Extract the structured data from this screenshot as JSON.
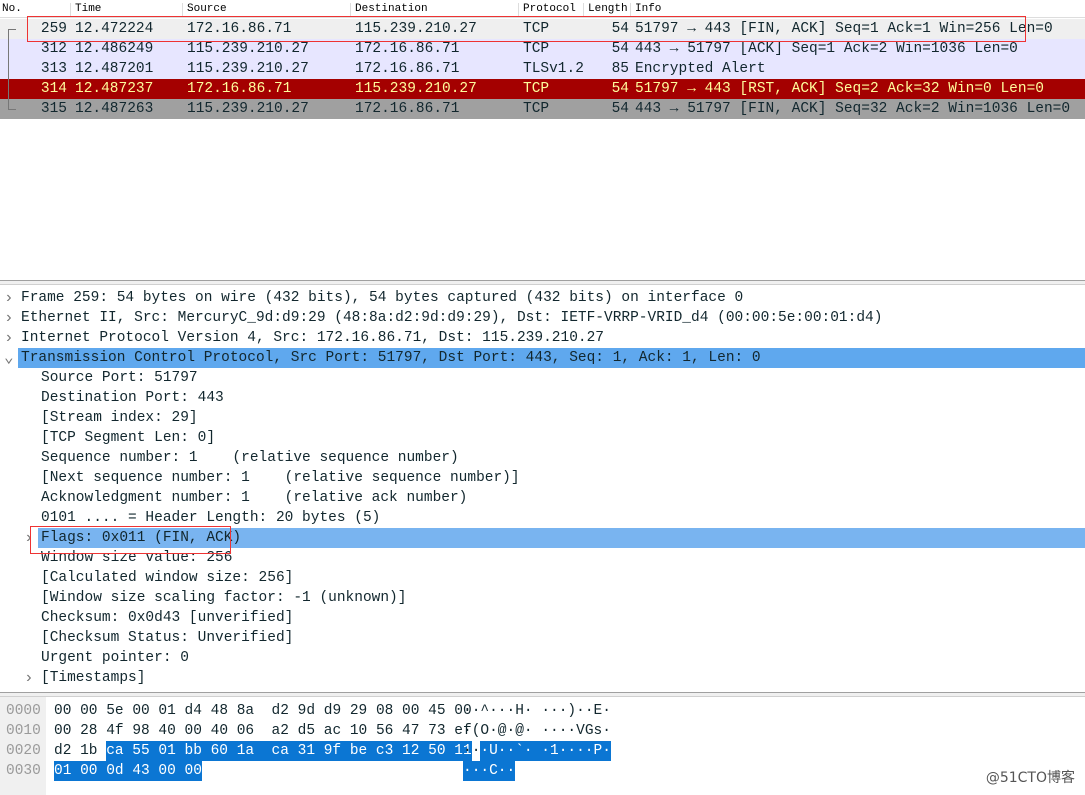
{
  "columns": {
    "no": "No.",
    "time": "Time",
    "source": "Source",
    "destination": "Destination",
    "protocol": "Protocol",
    "length": "Length",
    "info": "Info"
  },
  "packets": [
    {
      "no": "259",
      "time": "12.472224",
      "source": "172.16.86.71",
      "destination": "115.239.210.27",
      "protocol": "TCP",
      "length": "54",
      "info": "51797 → 443 [FIN, ACK] Seq=1 Ack=1 Win=256 Len=0",
      "bg": "#efefef",
      "fg": "#12272e"
    },
    {
      "no": "312",
      "time": "12.486249",
      "source": "115.239.210.27",
      "destination": "172.16.86.71",
      "protocol": "TCP",
      "length": "54",
      "info": "443 → 51797 [ACK] Seq=1 Ack=2 Win=1036 Len=0",
      "bg": "#e7e6ff",
      "fg": "#12272e"
    },
    {
      "no": "313",
      "time": "12.487201",
      "source": "115.239.210.27",
      "destination": "172.16.86.71",
      "protocol": "TLSv1.2",
      "length": "85",
      "info": "Encrypted Alert",
      "bg": "#e7e6ff",
      "fg": "#12272e"
    },
    {
      "no": "314",
      "time": "12.487237",
      "source": "172.16.86.71",
      "destination": "115.239.210.27",
      "protocol": "TCP",
      "length": "54",
      "info": "51797 → 443 [RST, ACK] Seq=2 Ack=32 Win=0 Len=0",
      "bg": "#a40000",
      "fg": "#fffc9c"
    },
    {
      "no": "315",
      "time": "12.487263",
      "source": "115.239.210.27",
      "destination": "172.16.86.71",
      "protocol": "TCP",
      "length": "54",
      "info": "443 → 51797 [FIN, ACK] Seq=32 Ack=2 Win=1036 Len=0",
      "bg": "#a0a0a0",
      "fg": "#12272e"
    }
  ],
  "details": [
    {
      "text": "Frame 259: 54 bytes on wire (432 bits), 54 bytes captured (432 bits) on interface 0",
      "level": 0,
      "expander": "collapsed"
    },
    {
      "text": "Ethernet II, Src: MercuryC_9d:d9:29 (48:8a:d2:9d:d9:29), Dst: IETF-VRRP-VRID_d4 (00:00:5e:00:01:d4)",
      "level": 0,
      "expander": "collapsed"
    },
    {
      "text": "Internet Protocol Version 4, Src: 172.16.86.71, Dst: 115.239.210.27",
      "level": 0,
      "expander": "collapsed"
    },
    {
      "text": "Transmission Control Protocol, Src Port: 51797, Dst Port: 443, Seq: 1, Ack: 1, Len: 0",
      "level": 0,
      "expander": "expanded",
      "highlight": "#5fa8ee"
    },
    {
      "text": "Source Port: 51797",
      "level": 1
    },
    {
      "text": "Destination Port: 443",
      "level": 1
    },
    {
      "text": "[Stream index: 29]",
      "level": 1
    },
    {
      "text": "[TCP Segment Len: 0]",
      "level": 1
    },
    {
      "text": "Sequence number: 1    (relative sequence number)",
      "level": 1
    },
    {
      "text": "[Next sequence number: 1    (relative sequence number)]",
      "level": 1
    },
    {
      "text": "Acknowledgment number: 1    (relative ack number)",
      "level": 1
    },
    {
      "text": "0101 .... = Header Length: 20 bytes (5)",
      "level": 1
    },
    {
      "text": "Flags: 0x011 (FIN, ACK)",
      "level": 1,
      "expander": "collapsed",
      "highlight": "#79b4f0"
    },
    {
      "text": "Window size value: 256",
      "level": 1
    },
    {
      "text": "[Calculated window size: 256]",
      "level": 1
    },
    {
      "text": "[Window size scaling factor: -1 (unknown)]",
      "level": 1
    },
    {
      "text": "Checksum: 0x0d43 [unverified]",
      "level": 1
    },
    {
      "text": "[Checksum Status: Unverified]",
      "level": 1
    },
    {
      "text": "Urgent pointer: 0",
      "level": 1
    },
    {
      "text": "[Timestamps]",
      "level": 1,
      "expander": "collapsed"
    }
  ],
  "hex": [
    {
      "offset": "0000",
      "hex_plain": "00 00 5e 00 01 d4 48 8a  d2 9d d9 29 08 00 45 00",
      "hex_sel": "",
      "ascii_plain": "··^···H· ···)··E·",
      "ascii_sel": ""
    },
    {
      "offset": "0010",
      "hex_plain": "00 28 4f 98 40 00 40 06  a2 d5 ac 10 56 47 73 ef",
      "hex_sel": "",
      "ascii_plain": "·(O·@·@· ····VGs·",
      "ascii_sel": ""
    },
    {
      "offset": "0020",
      "hex_plain": "d2 1b ",
      "hex_sel": "ca 55 01 bb 60 1a  ca 31 9f be c3 12 50 11",
      "ascii_plain": "··",
      "ascii_sel": "·U··`· ·1····P·"
    },
    {
      "offset": "0030",
      "hex_plain": "",
      "hex_sel": "01 00 0d 43 00 00",
      "ascii_plain": "",
      "ascii_sel": "···C··"
    }
  ],
  "watermark": "@51CTO博客"
}
